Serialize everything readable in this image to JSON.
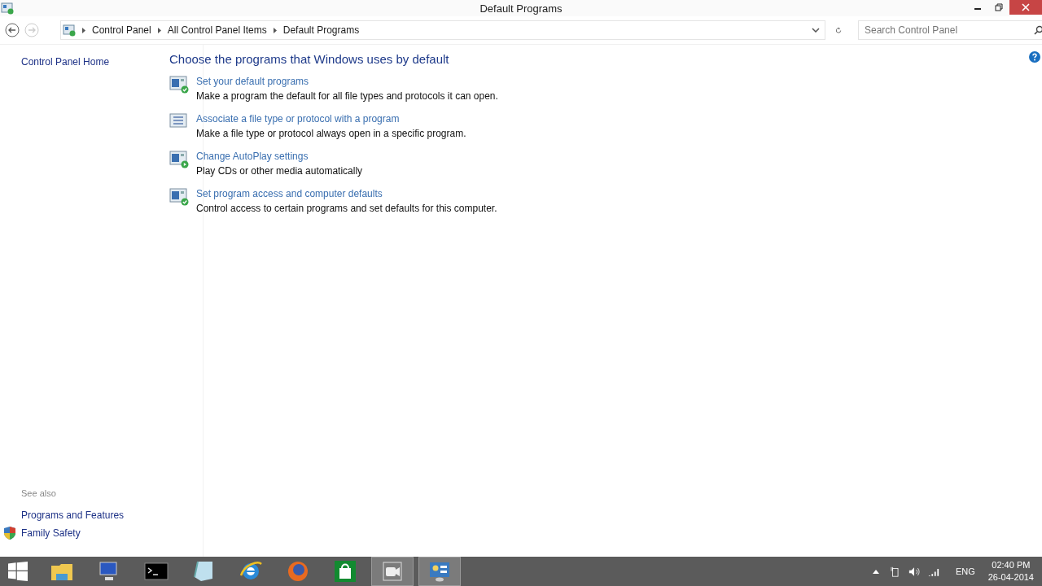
{
  "window": {
    "title": "Default Programs"
  },
  "breadcrumbs": [
    "Control Panel",
    "All Control Panel Items",
    "Default Programs"
  ],
  "search": {
    "placeholder": "Search Control Panel"
  },
  "sidebar": {
    "home": "Control Panel Home",
    "see_also_title": "See also",
    "see_also": [
      {
        "label": "Programs and Features",
        "kind": "plain"
      },
      {
        "label": "Family Safety",
        "kind": "shield"
      }
    ]
  },
  "heading": "Choose the programs that Windows uses by default",
  "tasks": [
    {
      "kind": "check",
      "link": "Set your default programs",
      "description": "Make a program the default for all file types and protocols it can open."
    },
    {
      "kind": "list",
      "link": "Associate a file type or protocol with a program",
      "description": "Make a file type or protocol always open in a specific program."
    },
    {
      "kind": "play",
      "link": "Change AutoPlay settings",
      "description": "Play CDs or other media automatically"
    },
    {
      "kind": "check",
      "link": "Set program access and computer defaults",
      "description": "Control access to certain programs and set defaults for this computer."
    }
  ],
  "taskbar": {
    "apps": [
      {
        "kind": "explorer",
        "active": false
      },
      {
        "kind": "computer",
        "active": false
      },
      {
        "kind": "console",
        "active": false
      },
      {
        "kind": "notepad",
        "active": false
      },
      {
        "kind": "browser-e",
        "active": false
      },
      {
        "kind": "browser-fox",
        "active": false
      },
      {
        "kind": "store",
        "active": false
      },
      {
        "kind": "camera",
        "active": true
      },
      {
        "kind": "panel",
        "active": true
      }
    ],
    "language": "ENG",
    "time": "02:40 PM",
    "date": "26-04-2014"
  }
}
